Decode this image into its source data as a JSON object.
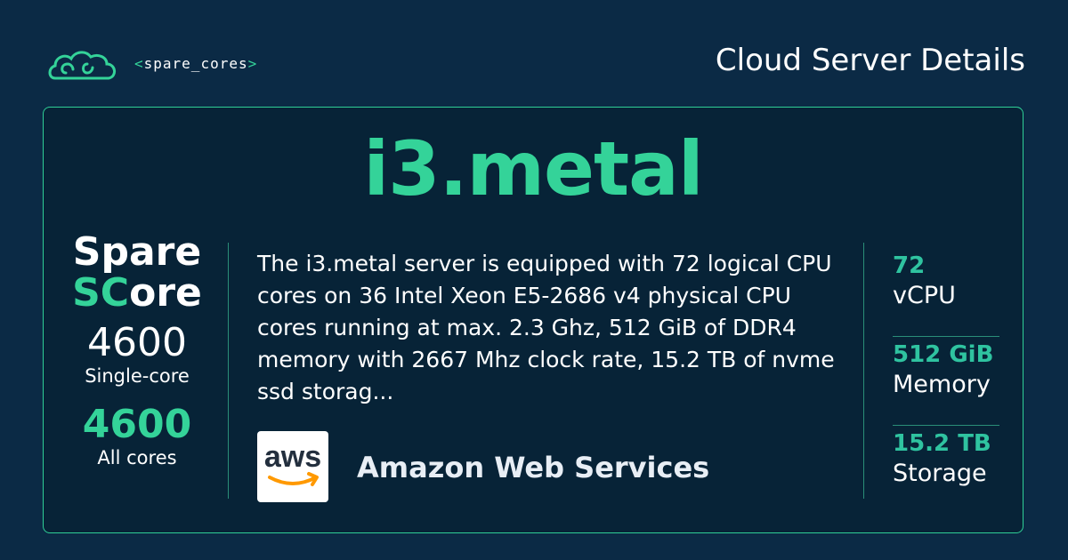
{
  "brand": {
    "name": "spare_cores",
    "open": "<",
    "close": ">"
  },
  "header": {
    "title": "Cloud Server Details"
  },
  "server": {
    "name": "i3.metal",
    "description": "The i3.metal server is equipped with 72 logical CPU cores on 36 Intel Xeon E5-2686 v4 physical CPU cores running at max. 2.3 Ghz, 512 GiB of DDR4 memory with 2667 Mhz clock rate, 15.2 TB of nvme ssd storag..."
  },
  "score": {
    "spare_label": "Spare",
    "score_prefix": "SC",
    "score_suffix": "ore",
    "single_value": "4600",
    "single_label": "Single-core",
    "all_value": "4600",
    "all_label": "All cores"
  },
  "vendor": {
    "name": "Amazon Web Services",
    "logo_text": "aws",
    "icon": "aws-logo"
  },
  "specs": [
    {
      "value": "72",
      "label": "vCPU"
    },
    {
      "value": "512 GiB",
      "label": "Memory"
    },
    {
      "value": "15.2 TB",
      "label": "Storage"
    }
  ],
  "colors": {
    "accent": "#34d399",
    "background": "#0b2a45",
    "card": "#072337"
  }
}
